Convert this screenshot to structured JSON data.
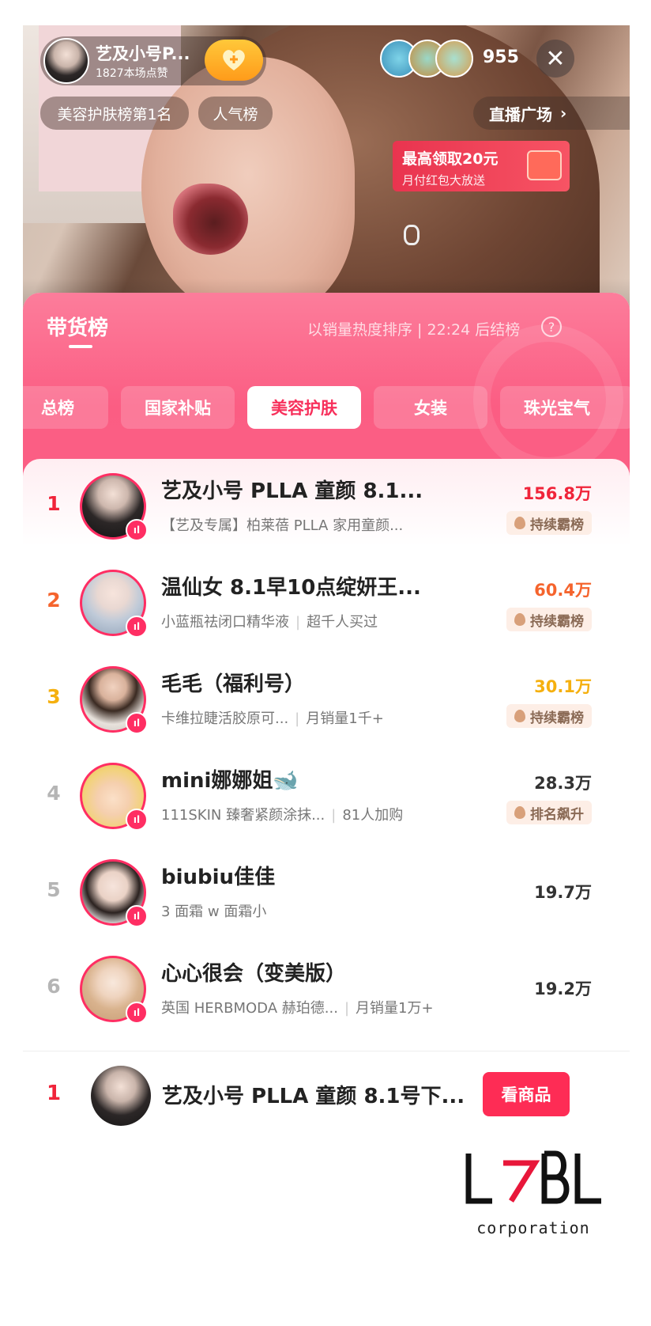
{
  "live": {
    "anchor_name": "艺及小号P...",
    "likes_text": "1827本场点赞",
    "viewer_count": "955",
    "rank_badge": "美容护肤榜第1名",
    "popular_badge": "人气榜",
    "plaza_label": "直播广场",
    "redpack_title": "最高领取20元",
    "redpack_sub": "月付红包大放送"
  },
  "panel": {
    "title": "带货榜",
    "note": "以销量热度排序 | 22:24 后结榜",
    "tabs": [
      "总榜",
      "国家补贴",
      "美容护肤",
      "女装",
      "珠光宝气"
    ],
    "active_tab": "美容护肤"
  },
  "ranking": [
    {
      "rank": "1",
      "name": "艺及小号 PLLA 童颜 8.1...",
      "desc": "【艺及专属】柏莱蓓 PLLA 家用童颜...",
      "extra": "",
      "value": "156.8万",
      "tag": "持续霸榜",
      "rank_color": "#f0243a",
      "value_color": "#f0243a"
    },
    {
      "rank": "2",
      "name": "温仙女 8.1早10点绽妍王...",
      "desc": "小蓝瓶祛闭口精华液",
      "extra": "超千人买过",
      "value": "60.4万",
      "tag": "持续霸榜",
      "rank_color": "#f5642d",
      "value_color": "#f5642d"
    },
    {
      "rank": "3",
      "name": "毛毛（福利号）",
      "desc": "卡维拉睫活胶原可...",
      "extra": "月销量1千+",
      "value": "30.1万",
      "tag": "持续霸榜",
      "rank_color": "#f5b00f",
      "value_color": "#f5b00f"
    },
    {
      "rank": "4",
      "name": "mini娜娜姐🐋",
      "desc": "111SKIN 臻奢紧颜涂抹...",
      "extra": "81人加购",
      "value": "28.3万",
      "tag": "排名飙升",
      "rank_color": "#b5b5b5",
      "value_color": "#333333"
    },
    {
      "rank": "5",
      "name": "biubiu佳佳",
      "desc": "3 面霜 w  面霜小",
      "extra": "",
      "value": "19.7万",
      "tag": "",
      "rank_color": "#b5b5b5",
      "value_color": "#333333"
    },
    {
      "rank": "6",
      "name": "心心很会（变美版）",
      "desc": "英国 HERBMODA 赫珀德...",
      "extra": "月销量1万+",
      "value": "19.2万",
      "tag": "",
      "rank_color": "#b5b5b5",
      "value_color": "#333333"
    }
  ],
  "bottom": {
    "rank": "1",
    "name": "艺及小号 PLLA 童颜 8.1号下...",
    "button": "看商品"
  },
  "watermark": {
    "logo_text": "LABL",
    "sub": "corporation"
  }
}
